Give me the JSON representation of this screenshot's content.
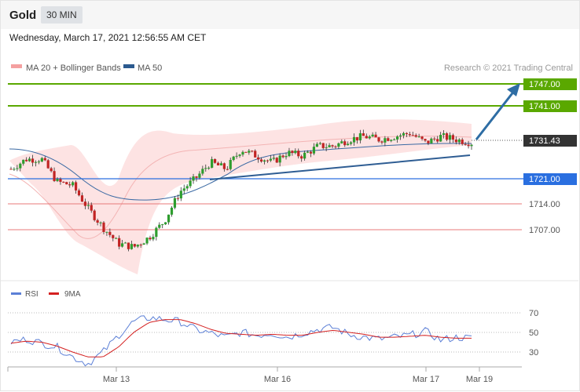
{
  "header": {
    "symbol": "Gold",
    "timeframe": "30 MIN",
    "datetime": "Wednesday, March 17, 2021 12:56:55 AM CET"
  },
  "legend": {
    "ma20": "MA 20 + Bollinger Bands",
    "ma50": "MA 50",
    "source": "Research © 2021 Trading Central"
  },
  "colors": {
    "ma20_band": "#f4a0a0",
    "ma50": "#2c5a8f",
    "resistance": "#5aa800",
    "pivot": "#2a6fe0",
    "support": "#e87a7a",
    "current": "#333333",
    "rsi": "#5b7fd6",
    "rsi_ma": "#d42020",
    "arrow": "#2e6da4"
  },
  "chart_data": [
    {
      "type": "line",
      "title": "Gold 30 MIN",
      "x": [
        "Mar 13",
        "Mar 16",
        "Mar 17",
        "Mar 19"
      ],
      "ylim": [
        1693,
        1752
      ],
      "levels": [
        {
          "label": "1747.00",
          "value": 1747.0,
          "kind": "resistance"
        },
        {
          "label": "1741.00",
          "value": 1741.0,
          "kind": "resistance"
        },
        {
          "label": "1731.43",
          "value": 1731.43,
          "kind": "current"
        },
        {
          "label": "1721.00",
          "value": 1721.0,
          "kind": "pivot"
        },
        {
          "label": "1714.00",
          "value": 1714.0,
          "kind": "support"
        },
        {
          "label": "1707.00",
          "value": 1707.0,
          "kind": "support"
        }
      ],
      "series": [
        {
          "name": "MA 20 + Bollinger Bands",
          "values": [
            1724,
            1722,
            1716,
            1708,
            1704,
            1706,
            1712,
            1720,
            1725,
            1726,
            1727,
            1728,
            1729,
            1730,
            1731,
            1732,
            1732,
            1732,
            1733,
            1732,
            1731
          ]
        },
        {
          "name": "MA 50",
          "values": [
            1730,
            1729,
            1724,
            1717,
            1712,
            1710,
            1710,
            1711,
            1712,
            1714,
            1717,
            1720,
            1723,
            1726,
            1728,
            1729,
            1730,
            1731,
            1731,
            1731,
            1731
          ]
        }
      ],
      "candles_approx_close": [
        1723,
        1726,
        1726,
        1719,
        1718,
        1711,
        1705,
        1700,
        1699,
        1702,
        1707,
        1716,
        1720,
        1725,
        1723,
        1729,
        1727,
        1725,
        1728,
        1727,
        1730,
        1730,
        1732,
        1733,
        1732,
        1733,
        1734,
        1731,
        1733,
        1732,
        1731
      ]
    },
    {
      "type": "line",
      "x": [
        "Mar 13",
        "Mar 16",
        "Mar 17",
        "Mar 19"
      ],
      "ylim": [
        23,
        82
      ],
      "ticks": [
        70,
        50,
        30
      ],
      "series": [
        {
          "name": "RSI",
          "values": [
            45,
            48,
            44,
            40,
            30,
            23,
            35,
            52,
            66,
            70,
            68,
            66,
            58,
            54,
            50,
            55,
            52,
            54,
            50,
            54,
            58,
            60,
            53,
            50,
            48,
            50,
            52,
            56,
            47,
            50,
            49
          ]
        },
        {
          "name": "9MA",
          "values": [
            44,
            46,
            45,
            41,
            35,
            30,
            30,
            40,
            55,
            65,
            68,
            68,
            64,
            58,
            54,
            53,
            52,
            53,
            52,
            52,
            55,
            57,
            55,
            53,
            50,
            50,
            51,
            52,
            50,
            49,
            49
          ]
        }
      ]
    }
  ]
}
